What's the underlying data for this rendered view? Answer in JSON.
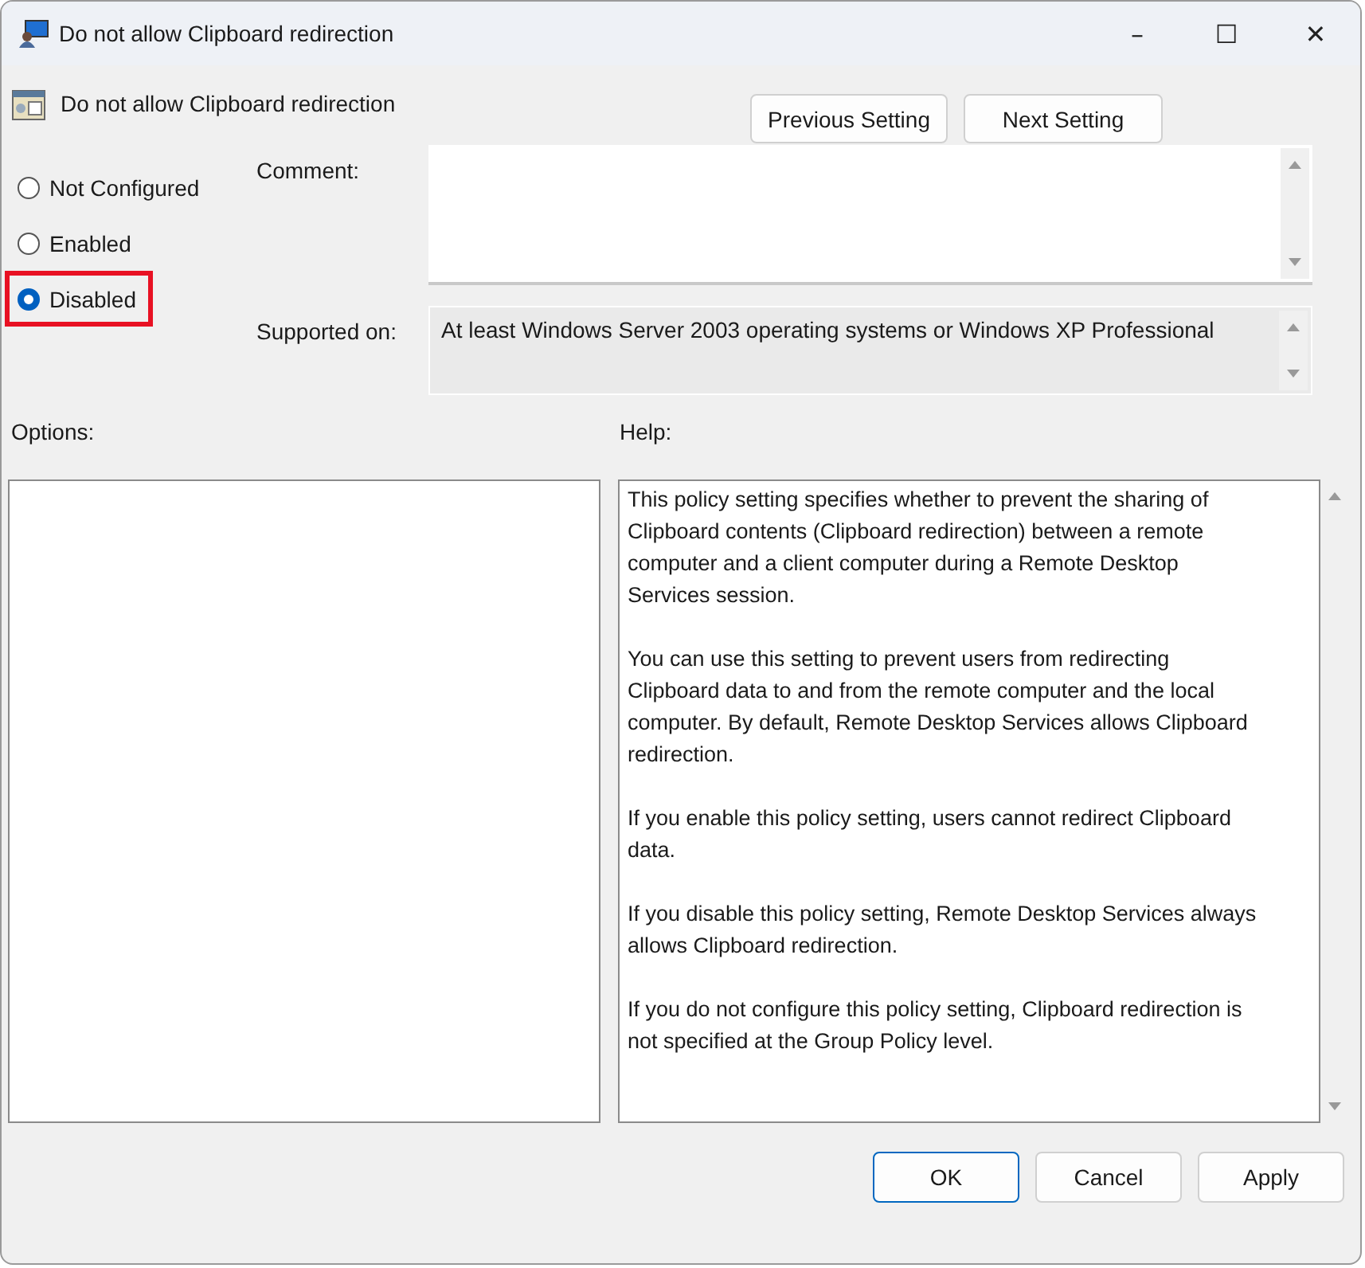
{
  "window": {
    "title": "Do not allow Clipboard redirection",
    "controls": [
      "–",
      "☐",
      "✕"
    ]
  },
  "header": {
    "title": "Do not allow Clipboard redirection"
  },
  "nav_buttons": [
    "Previous Setting",
    "Next Setting"
  ],
  "radios": [
    {
      "label": "Not Configured",
      "selected": false,
      "highlighted": false
    },
    {
      "label": "Enabled",
      "selected": false,
      "highlighted": false
    },
    {
      "label": "Disabled",
      "selected": true,
      "highlighted": true
    }
  ],
  "comment": {
    "label": "Comment:"
  },
  "supported": {
    "label": "Supported on:",
    "value": "At least Windows Server 2003 operating systems or Windows XP Professional"
  },
  "options": {
    "label": "Options:"
  },
  "help": {
    "label": "Help:",
    "paragraphs": [
      "This policy setting specifies whether to prevent the sharing of\nClipboard contents (Clipboard redirection) between a remote\ncomputer and a client computer during a Remote Desktop\nServices session.",
      "You can use this setting to prevent users from redirecting\nClipboard data to and from the remote computer and the local\ncomputer. By default, Remote Desktop Services allows Clipboard\nredirection.",
      "If you enable this policy setting, users cannot redirect Clipboard\ndata.",
      "If you disable this policy setting, Remote Desktop Services always\nallows Clipboard redirection.",
      "If you do not configure this policy setting, Clipboard redirection is\nnot specified at the Group Policy level."
    ]
  },
  "buttons": [
    {
      "label": "OK",
      "kind": "default"
    },
    {
      "label": "Cancel",
      "kind": "normal"
    },
    {
      "label": "Apply",
      "kind": "normal"
    }
  ]
}
